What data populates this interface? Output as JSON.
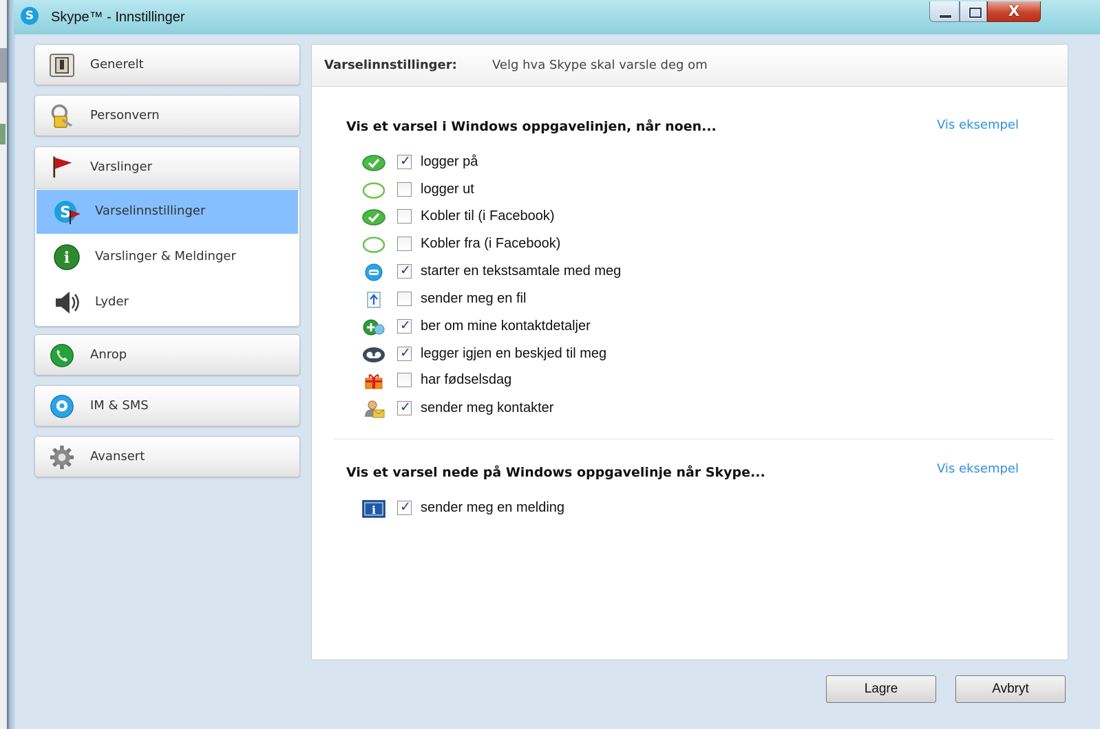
{
  "window": {
    "title": "Skype™ - Innstillinger",
    "logo_letter": "S",
    "close_glyph": "X"
  },
  "nav": {
    "items": [
      {
        "label": "Generelt",
        "icon": "switch-icon"
      },
      {
        "label": "Personvern",
        "icon": "lock-key-icon"
      },
      {
        "label": "Varslinger",
        "icon": "red-flag-icon"
      },
      {
        "label": "Anrop",
        "icon": "phone-icon"
      },
      {
        "label": "IM & SMS",
        "icon": "chat-bubble-icon"
      },
      {
        "label": "Avansert",
        "icon": "gear-icon"
      }
    ],
    "sub_items": [
      {
        "label": "Varselinnstillinger",
        "icon": "skype-flag-icon",
        "selected": true
      },
      {
        "label": "Varslinger & Meldinger",
        "icon": "info-icon",
        "selected": false
      },
      {
        "label": "Lyder",
        "icon": "speaker-icon",
        "selected": false
      }
    ]
  },
  "panel": {
    "header_bold": "Varselinnstillinger:",
    "header_desc": "Velg hva Skype skal varsle deg om",
    "section1": {
      "title": "Vis et varsel i Windows oppgavelinjen, når noen...",
      "link": "Vis eksempel",
      "options": [
        {
          "label": "logger på",
          "checked": true,
          "icon": "online-status-icon"
        },
        {
          "label": "logger ut",
          "checked": false,
          "icon": "offline-status-icon"
        },
        {
          "label": "Kobler til (i Facebook)",
          "checked": false,
          "icon": "online-status-icon"
        },
        {
          "label": "Kobler fra (i Facebook)",
          "checked": false,
          "icon": "offline-status-icon"
        },
        {
          "label": "starter en tekstsamtale med meg",
          "checked": true,
          "icon": "chat-icon"
        },
        {
          "label": "sender meg en fil",
          "checked": false,
          "icon": "file-upload-icon"
        },
        {
          "label": "ber om mine kontaktdetaljer",
          "checked": true,
          "icon": "add-contact-icon"
        },
        {
          "label": "legger igjen en beskjed til meg",
          "checked": true,
          "icon": "voicemail-icon"
        },
        {
          "label": "har fødselsdag",
          "checked": false,
          "icon": "gift-icon"
        },
        {
          "label": "sender meg kontakter",
          "checked": true,
          "icon": "contact-card-icon"
        }
      ]
    },
    "section2": {
      "title": "Vis et varsel nede på Windows oppgavelinje når Skype...",
      "link": "Vis eksempel",
      "options": [
        {
          "label": "sender meg en melding",
          "checked": true,
          "icon": "info-square-icon"
        }
      ]
    }
  },
  "buttons": {
    "save": "Lagre",
    "cancel": "Avbryt"
  }
}
